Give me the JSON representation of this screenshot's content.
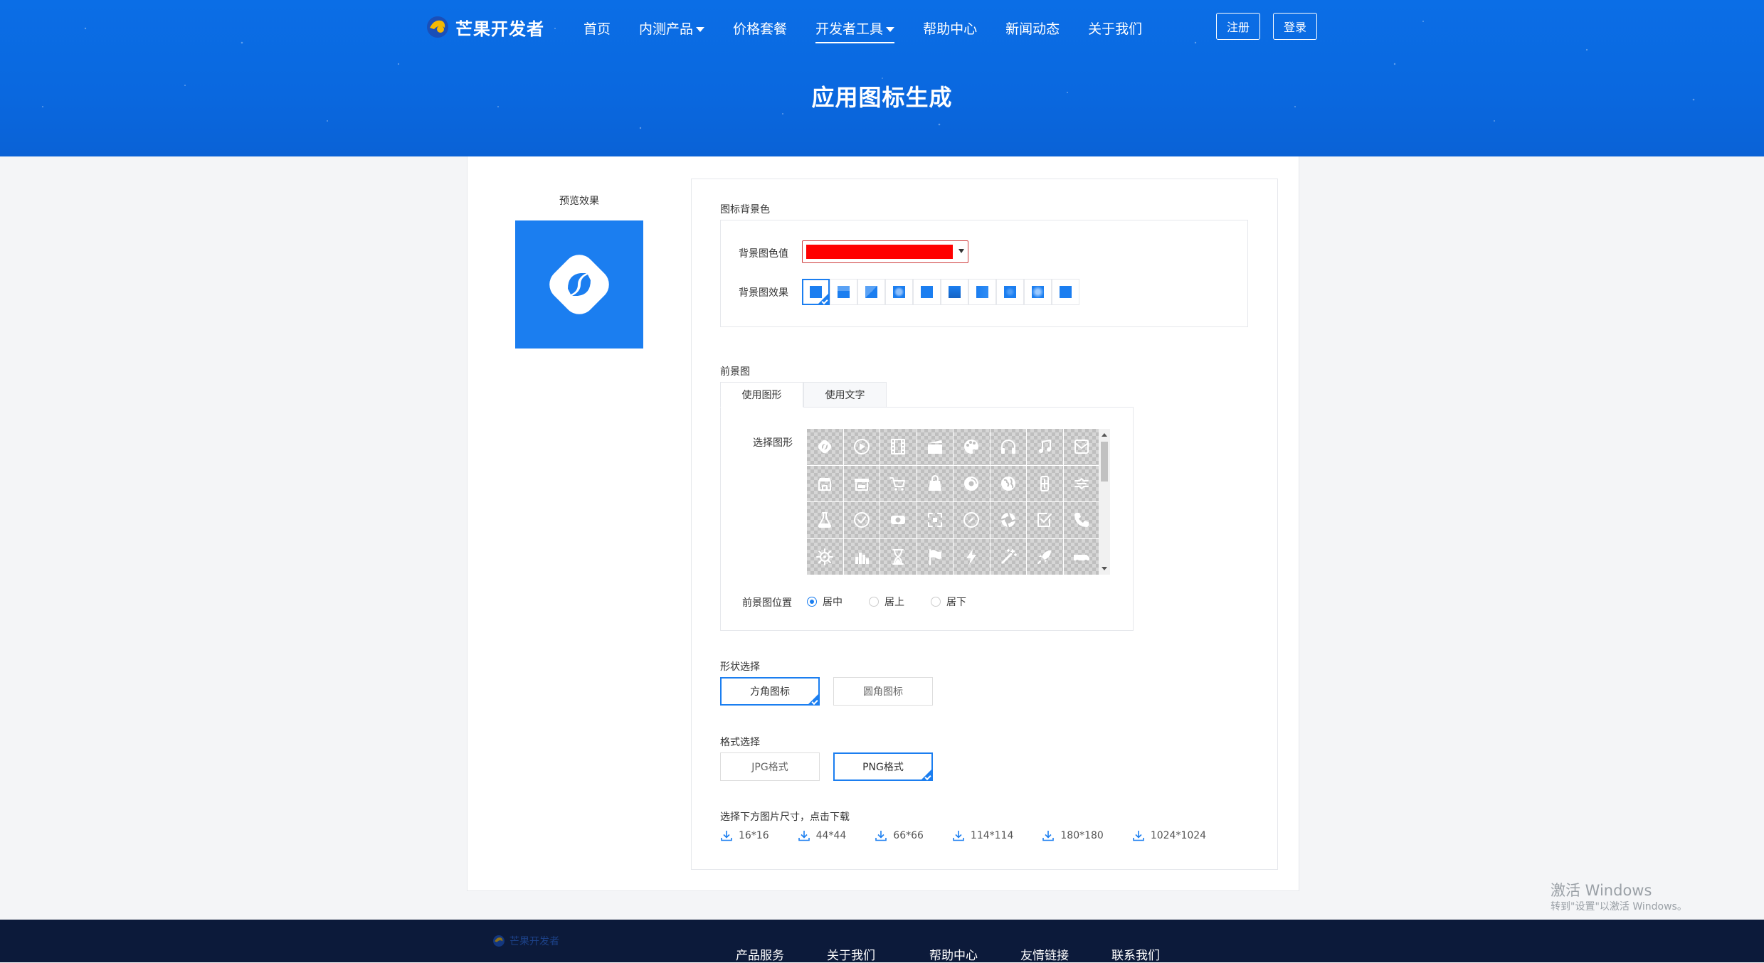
{
  "header": {
    "logo_text": "芒果开发者",
    "nav": [
      {
        "label": "首页",
        "dropdown": false,
        "active": false
      },
      {
        "label": "内测产品",
        "dropdown": true,
        "active": false
      },
      {
        "label": "价格套餐",
        "dropdown": false,
        "active": false
      },
      {
        "label": "开发者工具",
        "dropdown": true,
        "active": true
      },
      {
        "label": "帮助中心",
        "dropdown": false,
        "active": false
      },
      {
        "label": "新闻动态",
        "dropdown": false,
        "active": false
      },
      {
        "label": "关于我们",
        "dropdown": false,
        "active": false
      }
    ],
    "register_label": "注册",
    "login_label": "登录",
    "page_title": "应用图标生成"
  },
  "preview": {
    "label": "预览效果",
    "bg_color": "#1b7ef0"
  },
  "background": {
    "section_label": "图标背景色",
    "color_label": "背景图色值",
    "color_value": "#ff0000",
    "effect_label": "背景图效果",
    "effects_count": 10,
    "selected_effect": 0
  },
  "foreground": {
    "section_label": "前景图",
    "tabs": [
      {
        "label": "使用图形",
        "active": true
      },
      {
        "label": "使用文字",
        "active": false
      }
    ],
    "shape_label": "选择图形",
    "icons": [
      "logo-icon",
      "play-circle-icon",
      "film-icon",
      "clapper-icon",
      "palette-icon",
      "headphones-icon",
      "music-icon",
      "mail-icon",
      "store-icon",
      "shop-icon",
      "cart-icon",
      "shopping-bag-icon",
      "disc-icon",
      "globe-icon",
      "vertical-bar-icon",
      "tools-icon",
      "flask-icon",
      "check-circle-icon",
      "money-icon",
      "focus-icon",
      "compass-icon",
      "aperture-icon",
      "checkbox-icon",
      "phone-icon",
      "gear-icon",
      "bar-chart-icon",
      "hourglass-icon",
      "flag-icon",
      "lightning-icon",
      "magic-wand-icon",
      "rocket-icon",
      "truck-icon"
    ],
    "position_label": "前景图位置",
    "positions": [
      {
        "label": "居中",
        "checked": true
      },
      {
        "label": "居上",
        "checked": false
      },
      {
        "label": "居下",
        "checked": false
      }
    ]
  },
  "shape": {
    "section_label": "形状选择",
    "options": [
      {
        "label": "方角图标",
        "selected": true
      },
      {
        "label": "圆角图标",
        "selected": false
      }
    ]
  },
  "format": {
    "section_label": "格式选择",
    "options": [
      {
        "label": "JPG格式",
        "selected": false
      },
      {
        "label": "PNG格式",
        "selected": true
      }
    ]
  },
  "download": {
    "section_label": "选择下方图片尺寸，点击下载",
    "sizes": [
      "16*16",
      "44*44",
      "66*66",
      "114*114",
      "180*180",
      "1024*1024"
    ]
  },
  "watermark": {
    "line1": "激活 Windows",
    "line2": "转到\"设置\"以激活 Windows。"
  },
  "footer": {
    "logo_text": "芒果开发者",
    "links": [
      "产品服务",
      "关于我们",
      "帮助中心",
      "友情链接",
      "联系我们"
    ]
  },
  "colors": {
    "brand_blue": "#1b7ef0",
    "header_blue": "#0b6ee6",
    "footer_bg": "#0c1a3a"
  }
}
